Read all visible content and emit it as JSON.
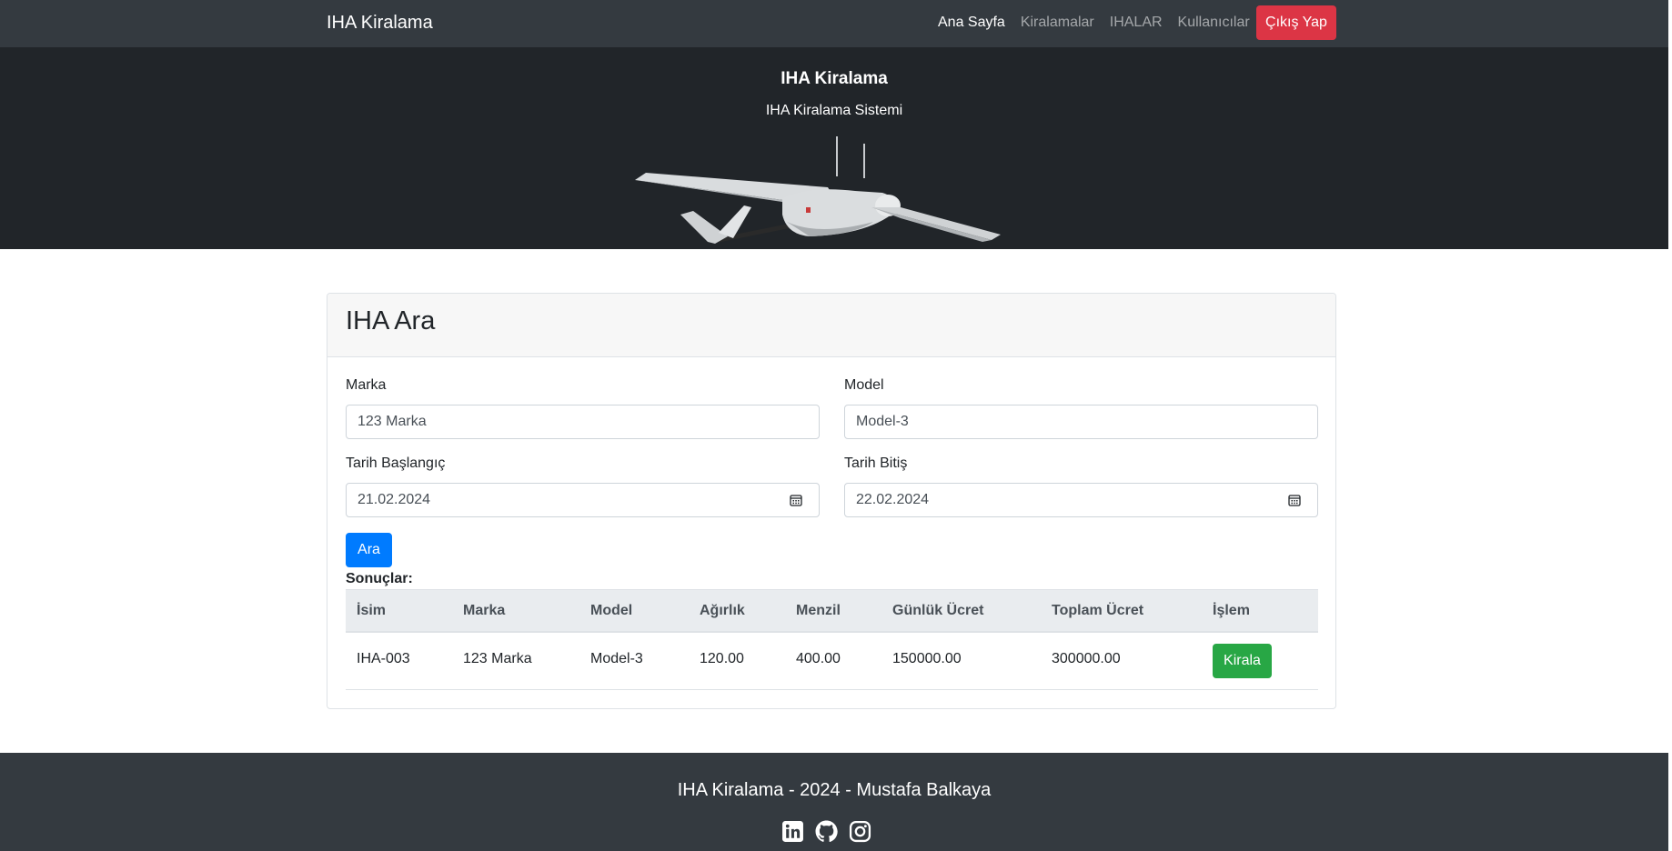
{
  "navbar": {
    "brand": "IHA Kiralama",
    "links": [
      {
        "label": "Ana Sayfa",
        "active": true
      },
      {
        "label": "Kiralamalar",
        "active": false
      },
      {
        "label": "IHALAR",
        "active": false
      },
      {
        "label": "Kullanıcılar",
        "active": false
      }
    ],
    "logout_label": "Çıkış Yap"
  },
  "hero": {
    "title": "IHA Kiralama",
    "subtitle": "IHA Kiralama Sistemi"
  },
  "search": {
    "title": "IHA Ara",
    "brand_label": "Marka",
    "brand_value": "123 Marka",
    "model_label": "Model",
    "model_value": "Model-3",
    "start_label": "Tarih Başlangıç",
    "start_value": "21.02.2024",
    "end_label": "Tarih Bitiş",
    "end_value": "22.02.2024",
    "search_button": "Ara"
  },
  "results": {
    "label": "Sonuçlar:",
    "columns": [
      "İsim",
      "Marka",
      "Model",
      "Ağırlık",
      "Menzil",
      "Günlük Ücret",
      "Toplam Ücret",
      "İşlem"
    ],
    "rows": [
      {
        "name": "IHA-003",
        "brand": "123 Marka",
        "model": "Model-3",
        "weight": "120.00",
        "range": "400.00",
        "daily_fee": "150000.00",
        "total_fee": "300000.00",
        "action_label": "Kirala"
      }
    ]
  },
  "footer": {
    "text": "IHA Kiralama - 2024 - Mustafa Balkaya",
    "icons": [
      "linkedin-icon",
      "github-icon",
      "instagram-icon"
    ]
  },
  "colors": {
    "navbar_bg": "#343a40",
    "hero_bg": "#212529",
    "primary": "#007bff",
    "danger": "#dc3545",
    "success": "#28a745"
  }
}
